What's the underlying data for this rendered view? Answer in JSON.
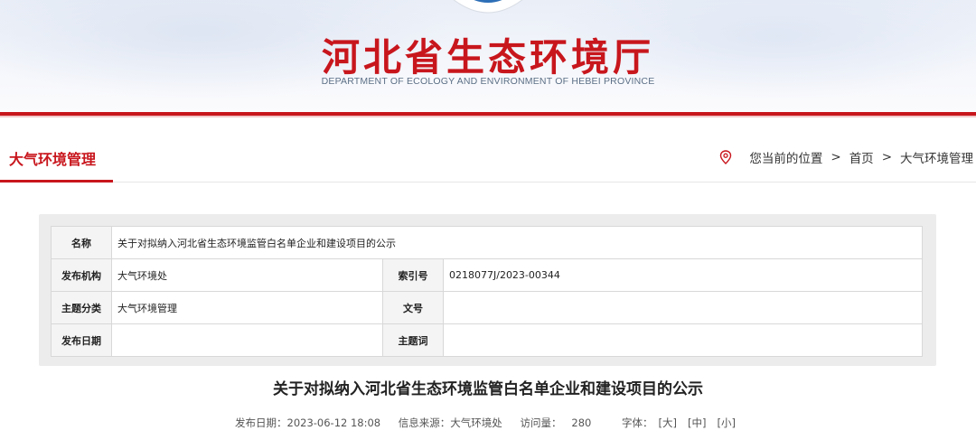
{
  "header": {
    "site_title": "河北省生态环境厅",
    "site_subtitle": "DEPARTMENT OF ECOLOGY AND ENVIRONMENT OF HEBEI PROVINCE"
  },
  "section": {
    "title": "大气环境管理",
    "breadcrumb_prefix": "您当前的位置",
    "breadcrumb_sep": ">",
    "crumbs": [
      "首页",
      "大气环境管理"
    ]
  },
  "info_table": {
    "name_label": "名称",
    "name_value": "关于对拟纳入河北省生态环境监管白名单企业和建设项目的公示",
    "org_label": "发布机构",
    "org_value": "大气环境处",
    "index_label": "索引号",
    "index_value": "0218077J/2023-00344",
    "topic_label": "主题分类",
    "topic_value": "大气环境管理",
    "docno_label": "文号",
    "docno_value": "",
    "date_label": "发布日期",
    "date_value": "",
    "keywords_label": "主题词",
    "keywords_value": ""
  },
  "article": {
    "title": "关于对拟纳入河北省生态环境监管白名单企业和建设项目的公示",
    "meta_date": "发布日期：2023-06-12 18:08",
    "meta_source": "信息来源：大气环境处",
    "meta_visits_label": "访问量：",
    "meta_visits_value": "280",
    "font_label": "字体：",
    "font_large": "[大]",
    "font_medium": "[中]",
    "font_small": "[小]"
  },
  "colors": {
    "brand_red": "#c8161d",
    "subtitle_blue": "#5c6f86"
  },
  "icons": {
    "location": "location-pin-icon",
    "emblem": "emblem-icon"
  }
}
